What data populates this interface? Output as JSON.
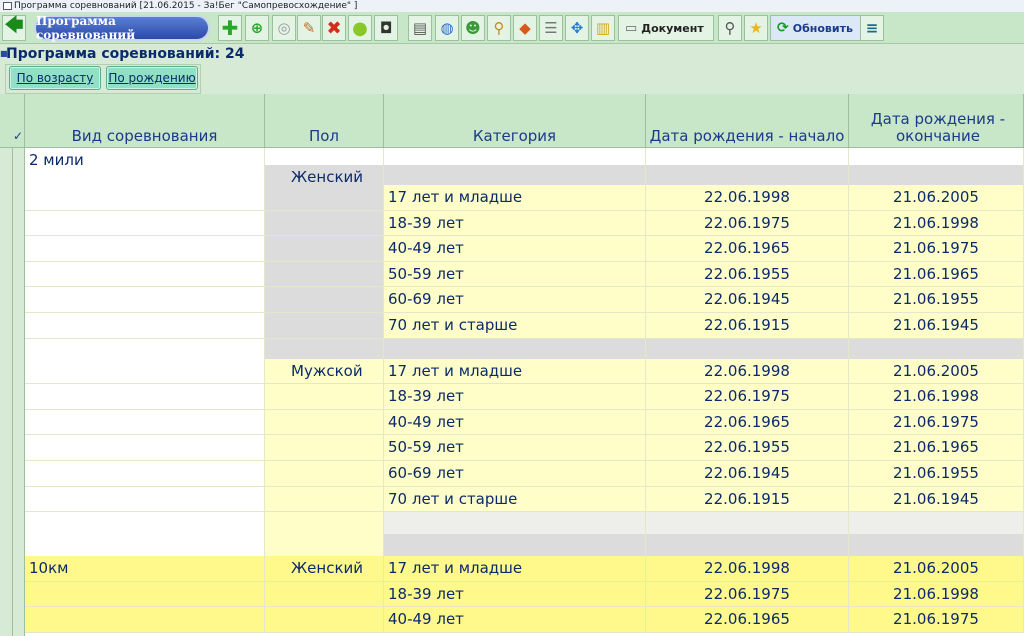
{
  "window": {
    "title": "Программа соревнований [21.06.2015 - За!Бег \"Самопревосхождение\" ]"
  },
  "toolbar": {
    "program_label": "Программа соревнований",
    "document_label": "Документ",
    "refresh_label": "Обновить"
  },
  "page": {
    "title": "Программа соревнований: 24",
    "sort_age": "По возрасту",
    "sort_birth": "По рождению"
  },
  "table": {
    "check_header": "✓",
    "headers": [
      "Вид соревнования",
      "Пол",
      "Категория",
      "Дата рождения - начало",
      "Дата рождения - окончание"
    ],
    "groups": [
      {
        "event": "2 мили",
        "sex": [
          {
            "label": "Женский",
            "rows": [
              [
                "17 лет и младше",
                "22.06.1998",
                "21.06.2005"
              ],
              [
                "18-39 лет",
                "22.06.1975",
                "21.06.1998"
              ],
              [
                "40-49 лет",
                "22.06.1965",
                "21.06.1975"
              ],
              [
                "50-59 лет",
                "22.06.1955",
                "21.06.1965"
              ],
              [
                "60-69 лет",
                "22.06.1945",
                "21.06.1955"
              ],
              [
                "70 лет и старше",
                "22.06.1915",
                "21.06.1945"
              ]
            ]
          },
          {
            "label": "Мужской",
            "rows": [
              [
                "17 лет и младше",
                "22.06.1998",
                "21.06.2005"
              ],
              [
                "18-39 лет",
                "22.06.1975",
                "21.06.1998"
              ],
              [
                "40-49 лет",
                "22.06.1965",
                "21.06.1975"
              ],
              [
                "50-59 лет",
                "22.06.1955",
                "21.06.1965"
              ],
              [
                "60-69 лет",
                "22.06.1945",
                "21.06.1955"
              ],
              [
                "70 лет и старше",
                "22.06.1915",
                "21.06.1945"
              ]
            ]
          }
        ]
      },
      {
        "event": "10км",
        "sex": [
          {
            "label": "Женский",
            "rows": [
              [
                "17 лет и младше",
                "22.06.1998",
                "21.06.2005"
              ],
              [
                "18-39 лет",
                "22.06.1975",
                "21.06.1998"
              ],
              [
                "40-49 лет",
                "22.06.1965",
                "21.06.1975"
              ]
            ]
          }
        ]
      }
    ]
  },
  "icons": [
    "back-arrow-icon",
    "add-icon",
    "add-magnify-icon",
    "disc-icon",
    "pencil-icon",
    "delete-icon",
    "circle-icon",
    "camera-icon",
    "printer-icon",
    "globe-icon",
    "user-icon",
    "search-icon",
    "diamond-icon",
    "page-icon",
    "move-icon",
    "chart-icon",
    "search-icon",
    "star-icon",
    "refresh-icon",
    "menu-icon"
  ]
}
